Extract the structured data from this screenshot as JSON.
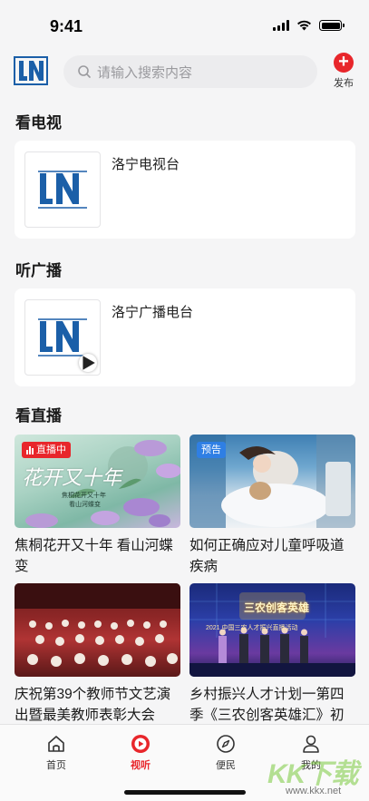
{
  "status_bar": {
    "time": "9:41"
  },
  "header": {
    "search_placeholder": "请输入搜索内容",
    "publish_label": "发布",
    "brand_color": "#1b5fa8",
    "accent_color": "#e8262b"
  },
  "tv": {
    "section_title": "看电视",
    "channel_name": "洛宁电视台"
  },
  "radio": {
    "section_title": "听广播",
    "channel_name": "洛宁广播电台"
  },
  "live": {
    "section_title": "看直播",
    "items": [
      {
        "title": "焦桐花开又十年 看山河蝶变",
        "badge": "直播中",
        "image_text": "花开又十年",
        "image_sub_1": "焦桐花开又十年",
        "image_sub_2": "看山河蝶变"
      },
      {
        "title": "如何正确应对儿童呼吸道疾病",
        "badge": "预告"
      },
      {
        "title": "庆祝第39个教师节文艺演出暨最美教师表彰大会",
        "badge": ""
      },
      {
        "title": "乡村振兴人才计划一第四季《三农创客英雄汇》初",
        "badge": "",
        "image_text": "三农创客英雄",
        "image_banner": "2021 中国三农人才振兴直播活动"
      }
    ]
  },
  "tabbar": {
    "tabs": [
      {
        "label": "首页",
        "icon": "home-icon"
      },
      {
        "label": "视听",
        "icon": "play-circle-icon",
        "active": true
      },
      {
        "label": "便民",
        "icon": "compass-icon"
      },
      {
        "label": "我的",
        "icon": "person-icon"
      }
    ]
  },
  "watermark": {
    "text": "KK下载",
    "url": "www.kkx.net"
  }
}
